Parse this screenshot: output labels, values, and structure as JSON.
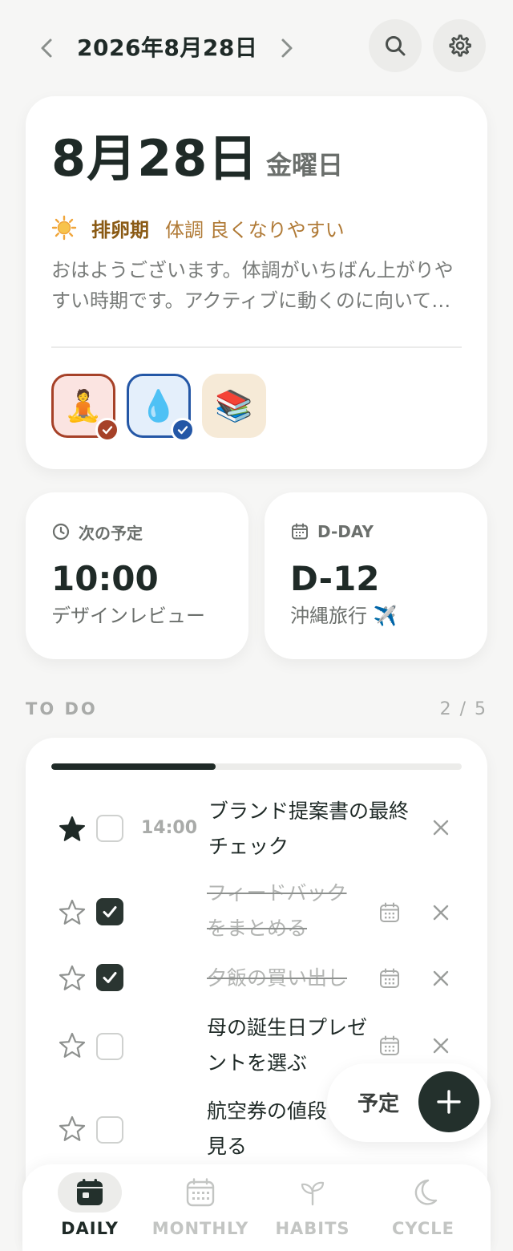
{
  "header": {
    "date": "2026年8月28日",
    "prev_icon": "chevron-left-icon",
    "next_icon": "chevron-right-icon",
    "search_icon": "search-icon",
    "settings_icon": "gear-icon"
  },
  "today": {
    "date": "8月28日",
    "weekday": "金曜日",
    "phase_icon": "sun-icon",
    "phase_name": "排卵期",
    "phase_desc": "体調 良くなりやすい",
    "greeting": "おはようございます。体調がいちばん上がりやすい時期です。アクティブに動くのに向いています。",
    "habits": [
      {
        "icon": "🧘",
        "name": "meditation",
        "done": true,
        "color": "#a64128"
      },
      {
        "icon": "💧",
        "name": "water",
        "done": true,
        "color": "#2457a6"
      },
      {
        "icon": "📚",
        "name": "reading",
        "done": false
      }
    ]
  },
  "next_event": {
    "label": "次の予定",
    "time": "10:00",
    "title": "デザインレビュー"
  },
  "dday": {
    "label": "D-DAY",
    "value": "D-12",
    "title": "沖縄旅行 ✈️"
  },
  "todo": {
    "title": "TO DO",
    "count": "2 / 5",
    "progress": 0.4,
    "items": [
      {
        "text": "ブランド提案書の最終チェック",
        "time": "14:00",
        "starred": true,
        "done": false
      },
      {
        "text": "フィードバックをまとめる",
        "starred": false,
        "done": true
      },
      {
        "text": "夕飯の買い出し",
        "starred": false,
        "done": true
      },
      {
        "text": "母の誕生日プレゼントを選ぶ",
        "starred": false,
        "done": false
      },
      {
        "text": "航空券の値段を見る",
        "starred": false,
        "done": false
      }
    ]
  },
  "fab": {
    "label": "予定",
    "icon": "plus-icon"
  },
  "nav": {
    "items": [
      {
        "label": "DAILY",
        "icon": "calendar-day-icon",
        "active": true
      },
      {
        "label": "MONTHLY",
        "icon": "calendar-month-icon",
        "active": false
      },
      {
        "label": "HABITS",
        "icon": "sprout-icon",
        "active": false
      },
      {
        "label": "CYCLE",
        "icon": "moon-icon",
        "active": false
      }
    ]
  }
}
